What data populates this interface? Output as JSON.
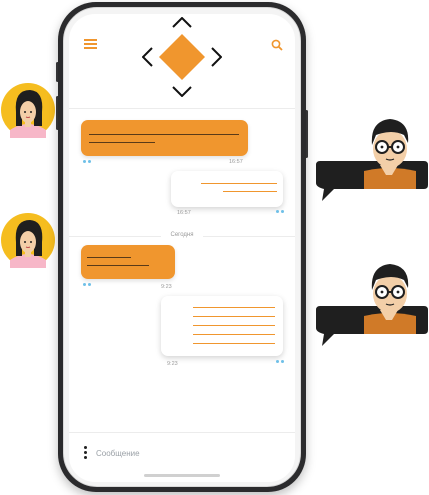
{
  "chat": {
    "date_separator": "Сегодня",
    "messages": [
      {
        "direction": "incoming",
        "time": "16:57"
      },
      {
        "direction": "outgoing",
        "time": "16:57"
      },
      {
        "direction": "incoming",
        "time": "9:23"
      },
      {
        "direction": "outgoing",
        "time": "9:23"
      }
    ]
  },
  "composer": {
    "placeholder": "Сообщение"
  },
  "icons": {
    "header_left": "menu-icon",
    "header_right": "search-icon",
    "logo": "diamond-logo",
    "composer_left": "more-vertical-icon"
  },
  "colors": {
    "accent": "#f0962e",
    "phone_frame": "#2b2b2d",
    "read_receipt": "#6fc0e8",
    "avatar_bg": "#f5bd1f",
    "bubble_dark": "#1f1f1f"
  }
}
